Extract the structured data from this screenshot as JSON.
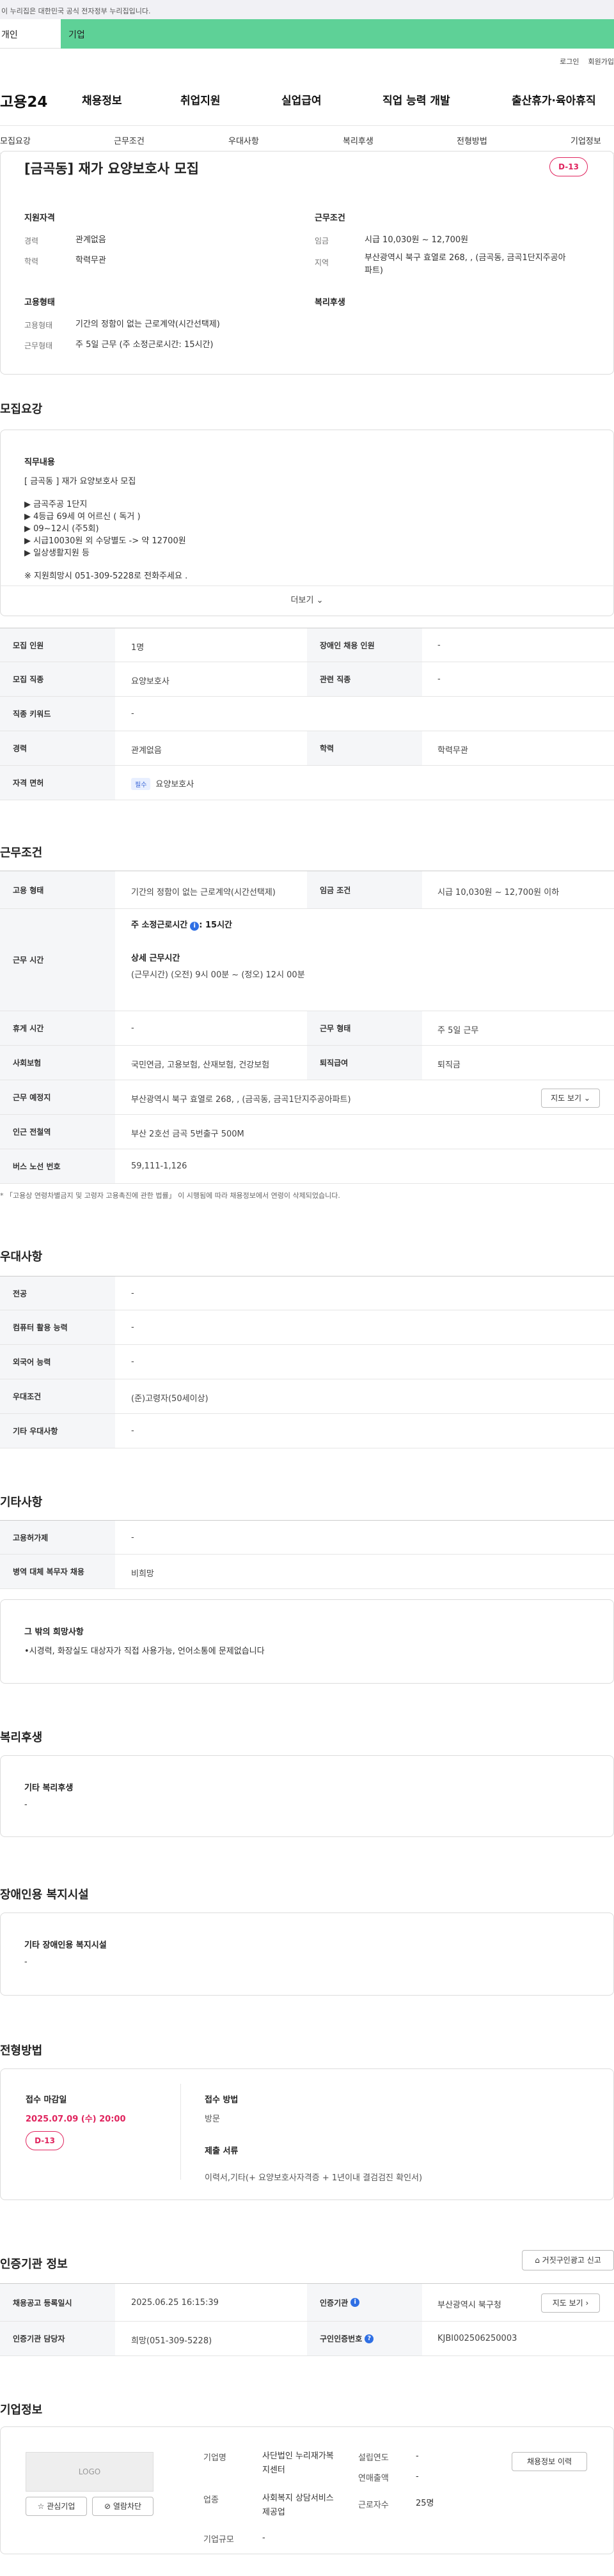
{
  "gov_banner": "이 누리집은 대한민국 공식 전자정부 누리집입니다.",
  "top_tabs": {
    "person": "개인",
    "biz": "기업"
  },
  "util": {
    "login": "로그인",
    "signup": "회원가입"
  },
  "nav": {
    "logo": "고용24",
    "items": [
      "채용정보",
      "취업지원",
      "실업급여",
      "직업 능력 개발",
      "출산휴가·육아휴직"
    ]
  },
  "subtabs": [
    "모집요강",
    "근무조건",
    "우대사항",
    "복리후생",
    "전형방법",
    "기업정보"
  ],
  "job": {
    "title": "[금곡동] 재가 요양보호사 모집",
    "dday": "D-13"
  },
  "summary": {
    "qual_h": "지원자격",
    "cond_h": "근무조건",
    "emp_h": "고용형태",
    "welfare_h": "복리후생",
    "career_k": "경력",
    "career_v": "관계없음",
    "edu_k": "학력",
    "edu_v": "학력무관",
    "wage_k": "임금",
    "wage_v": "시급 10,030원 ~ 12,700원",
    "loc_k": "지역",
    "loc_v": "부산광역시 북구 효열로 268, , (금곡동, 금곡1단지주공아파트)",
    "emptype_k": "고용형태",
    "emptype_v": "기간의 정함이 없는 근로계약(시간선택제)",
    "worktype_k": "근무형태",
    "worktype_v": "주 5일 근무 (주 소정근로시간: 15시간)"
  },
  "recruit": {
    "title": "모집요강",
    "duty_h": "직무내용",
    "lines": [
      "[ 금곡동 ] 재가 요양보호사 모집",
      "",
      "▶ 금곡주공 1단지",
      "▶ 4등급 69세 여 어르신 ( 독거 )",
      "▶ 09~12시 (주5회)",
      "▶ 시급10030원 외 수당별도 -> 약 12700원",
      "▶ 일상생활지원 등",
      "",
      "※ 지원희망시 051-309-5228로 전화주세요 ."
    ],
    "more": "더보기",
    "rows": [
      {
        "k1": "모집 인원",
        "v1": "1명",
        "k2": "장애인 채용 인원",
        "v2": "-"
      },
      {
        "k1": "모집 직종",
        "v1": "요양보호사",
        "k2": "관련 직종",
        "v2": "-"
      },
      {
        "k1": "직종 키워드",
        "v1": "-"
      },
      {
        "k1": "경력",
        "v1": "관계없음",
        "k2": "학력",
        "v2": "학력무관"
      },
      {
        "k1": "자격 면허",
        "badge": "필수",
        "v1": "요양보호사"
      }
    ]
  },
  "cond": {
    "title": "근무조건",
    "emptype_k": "고용 형태",
    "emptype_v": "기간의 정함이 없는 근로계약(시간선택제)",
    "wage_k": "임금 조건",
    "wage_v": "시급 10,030원 ~ 12,700원 이하",
    "hours_k": "근무 시간",
    "hours_weekly_label": "주 소정근로시간",
    "hours_weekly_value": ": 15시간",
    "hours_detail_h": "상세 근무시간",
    "hours_detail_v": "(근무시간) (오전) 9시 00분 ~ (정오) 12시 00분",
    "rest_k": "휴게 시간",
    "rest_v": "-",
    "worktype_k": "근무 형태",
    "worktype_v": "주 5일 근무",
    "ins_k": "사회보험",
    "ins_v": "국민연금, 고용보험, 산재보험, 건강보험",
    "sev_k": "퇴직급여",
    "sev_v": "퇴직금",
    "place_k": "근무 예정지",
    "place_v": "부산광역시 북구 효열로 268, , (금곡동, 금곡1단지주공아파트)",
    "map_btn": "지도 보기",
    "subway_k": "인근 전철역",
    "subway_v": "부산 2호선 금곡 5번출구 500M",
    "bus_k": "버스 노선 번호",
    "bus_v": "59,111-1,126",
    "note": "* 「고용상 연령차별금지 및 고령자 고용촉진에 관한 법률」 이 시행됨에 따라 채용정보에서 연령이 삭제되었습니다."
  },
  "pref": {
    "title": "우대사항",
    "rows": [
      {
        "k": "전공",
        "v": "-"
      },
      {
        "k": "컴퓨터 활용 능력",
        "v": "-"
      },
      {
        "k": "외국어 능력",
        "v": "-"
      },
      {
        "k": "우대조건",
        "v": "(준)고령자(50세이상)"
      },
      {
        "k": "기타 우대사항",
        "v": "-"
      }
    ]
  },
  "etc": {
    "title": "기타사항",
    "rows": [
      {
        "k": "고용허가제",
        "v": "-"
      },
      {
        "k": "병역 대체 복무자 채용",
        "v": "비희망"
      }
    ],
    "wish_h": "그 밖의 희망사항",
    "wish_v": "•시경력, 화장실도 대상자가  직접 사용가능, 언어소통에 문제없습니다"
  },
  "welfare": {
    "title": "복리후생",
    "h": "기타 복리후생",
    "v": "-"
  },
  "disab": {
    "title": "장애인용 복지시설",
    "h": "기타 장애인용 복지시설",
    "v": "-"
  },
  "process": {
    "title": "전형방법",
    "deadline_h": "접수 마감일",
    "deadline_v": "2025.07.09 (수) 20:00",
    "dday": "D-13",
    "method_h": "접수 방법",
    "method_v": "방문",
    "docs_h": "제출 서류",
    "docs_v": "이력서,기타(+ 요양보호사자격증  + 1년이내 결검검진 확인서)"
  },
  "agency": {
    "title": "인증기관 정보",
    "report_btn": "거짓구인광고 신고",
    "reg_k": "채용공고 등록일시",
    "reg_v": "2025.06.25 16:15:39",
    "org_k": "인증기관",
    "org_v": "부산광역시 북구청",
    "map_btn": "지도 보기",
    "mgr_k": "인증기관 담당자",
    "mgr_v": "희망(051-309-5228)",
    "num_k": "구인인증번호",
    "num_v": "KJBI002506250003"
  },
  "company": {
    "title": "기업정보",
    "logo": "LOGO",
    "fav_btn": "관심기업",
    "block_btn": "열람차단",
    "name_k": "기업명",
    "name_v": "사단법인 누리재가복지센터",
    "year_k": "설립연도",
    "year_v": "-",
    "sales_k": "연매출액",
    "sales_v": "-",
    "biz_k": "업종",
    "biz_v": "사회복지 상담서비스 제공업",
    "emp_k": "근로자수",
    "emp_v": "25명",
    "size_k": "기업규모",
    "size_v": "-",
    "hist_btn": "채용정보 이력"
  }
}
